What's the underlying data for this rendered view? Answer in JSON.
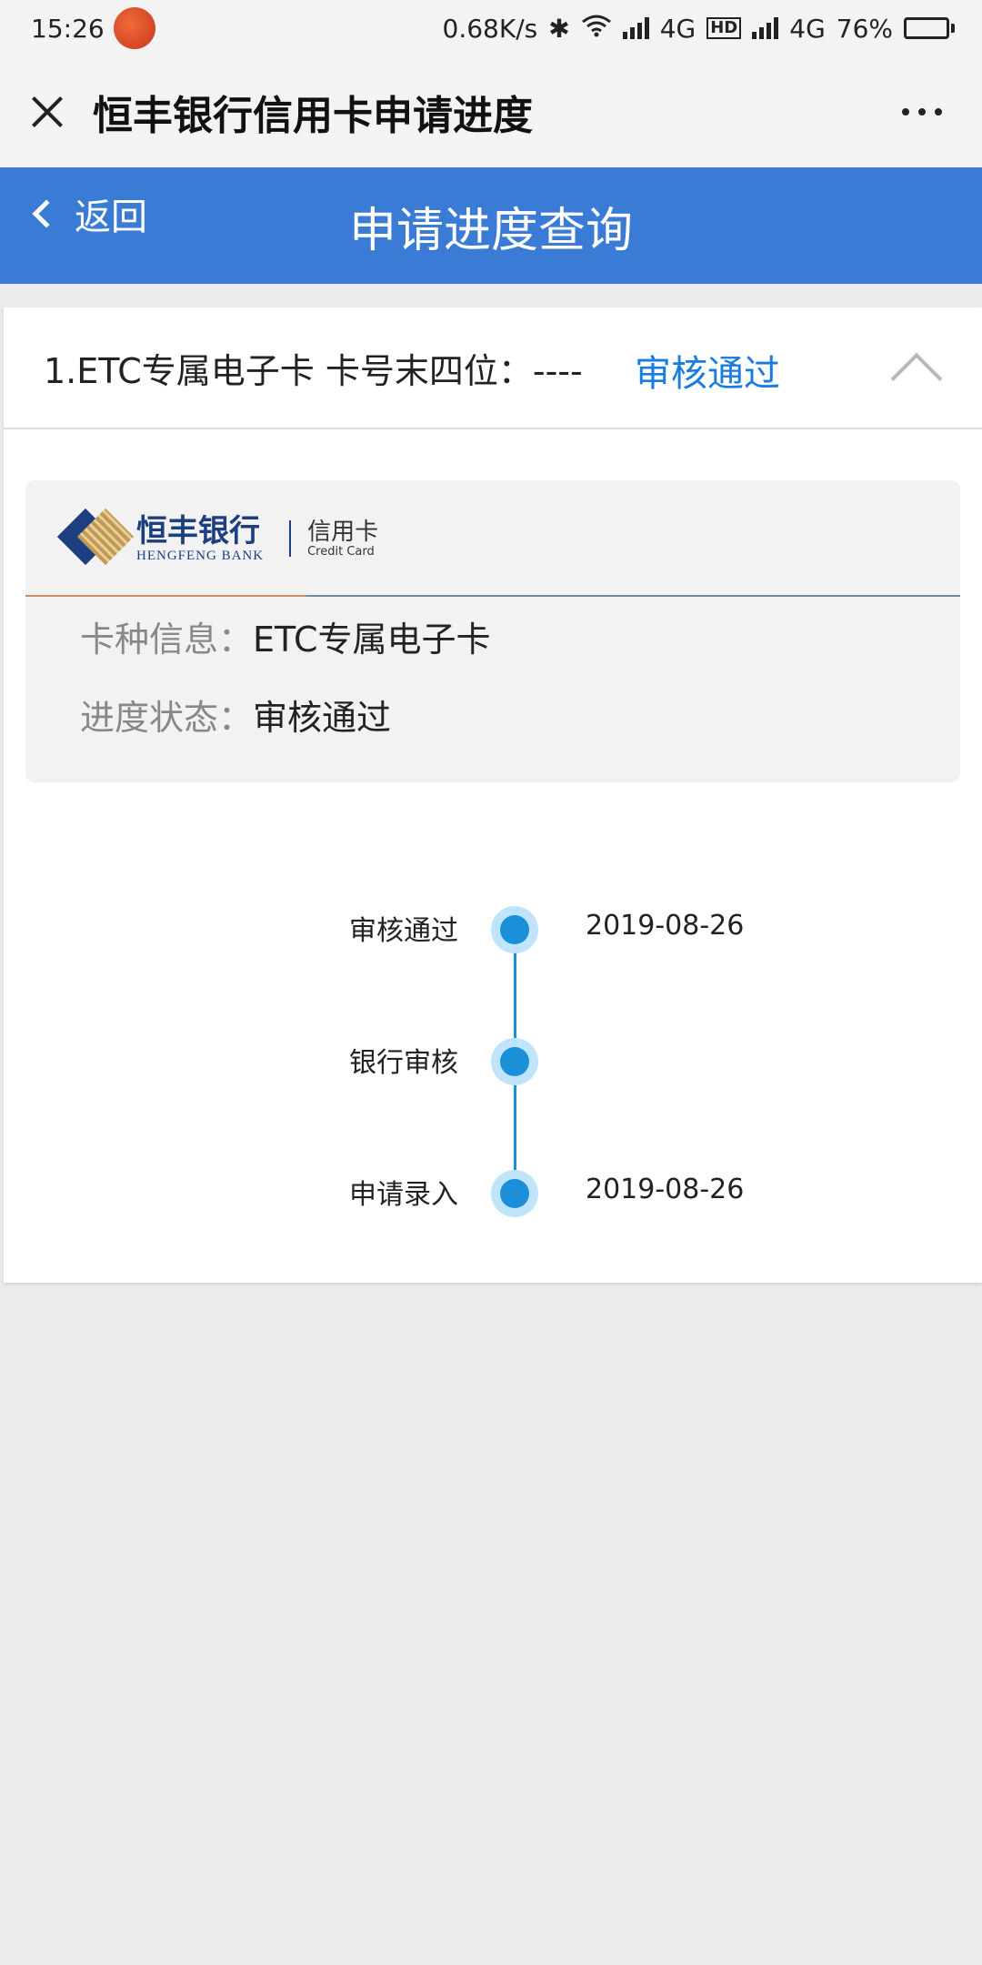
{
  "status_bar": {
    "time": "15:26",
    "app_badge": "",
    "speed": "0.68K/s",
    "net1": "4G",
    "hd": "HD",
    "net2": "4G",
    "battery": "76%",
    "battery_level": 0.76
  },
  "title_bar": {
    "title": "恒丰银行信用卡申请进度"
  },
  "header": {
    "back_label": "返回",
    "page_title": "申请进度查询",
    "accent_color": "#3a7bd5"
  },
  "card": {
    "heading": "1.ETC专属电子卡 卡号末四位：----",
    "status": "审核通过",
    "status_color": "#1a7be0",
    "logo": {
      "bank_cn": "恒丰银行",
      "bank_en": "HENGFENG BANK",
      "sub_cn": "信用卡",
      "sub_en": "Credit Card"
    },
    "info": {
      "card_type_label": "卡种信息：",
      "card_type_value": "ETC专属电子卡",
      "progress_label": "进度状态：",
      "progress_value": "审核通过"
    },
    "timeline": [
      {
        "label": "审核通过",
        "date": "2019-08-26"
      },
      {
        "label": "银行审核",
        "date": ""
      },
      {
        "label": "申请录入",
        "date": "2019-08-26"
      }
    ]
  }
}
